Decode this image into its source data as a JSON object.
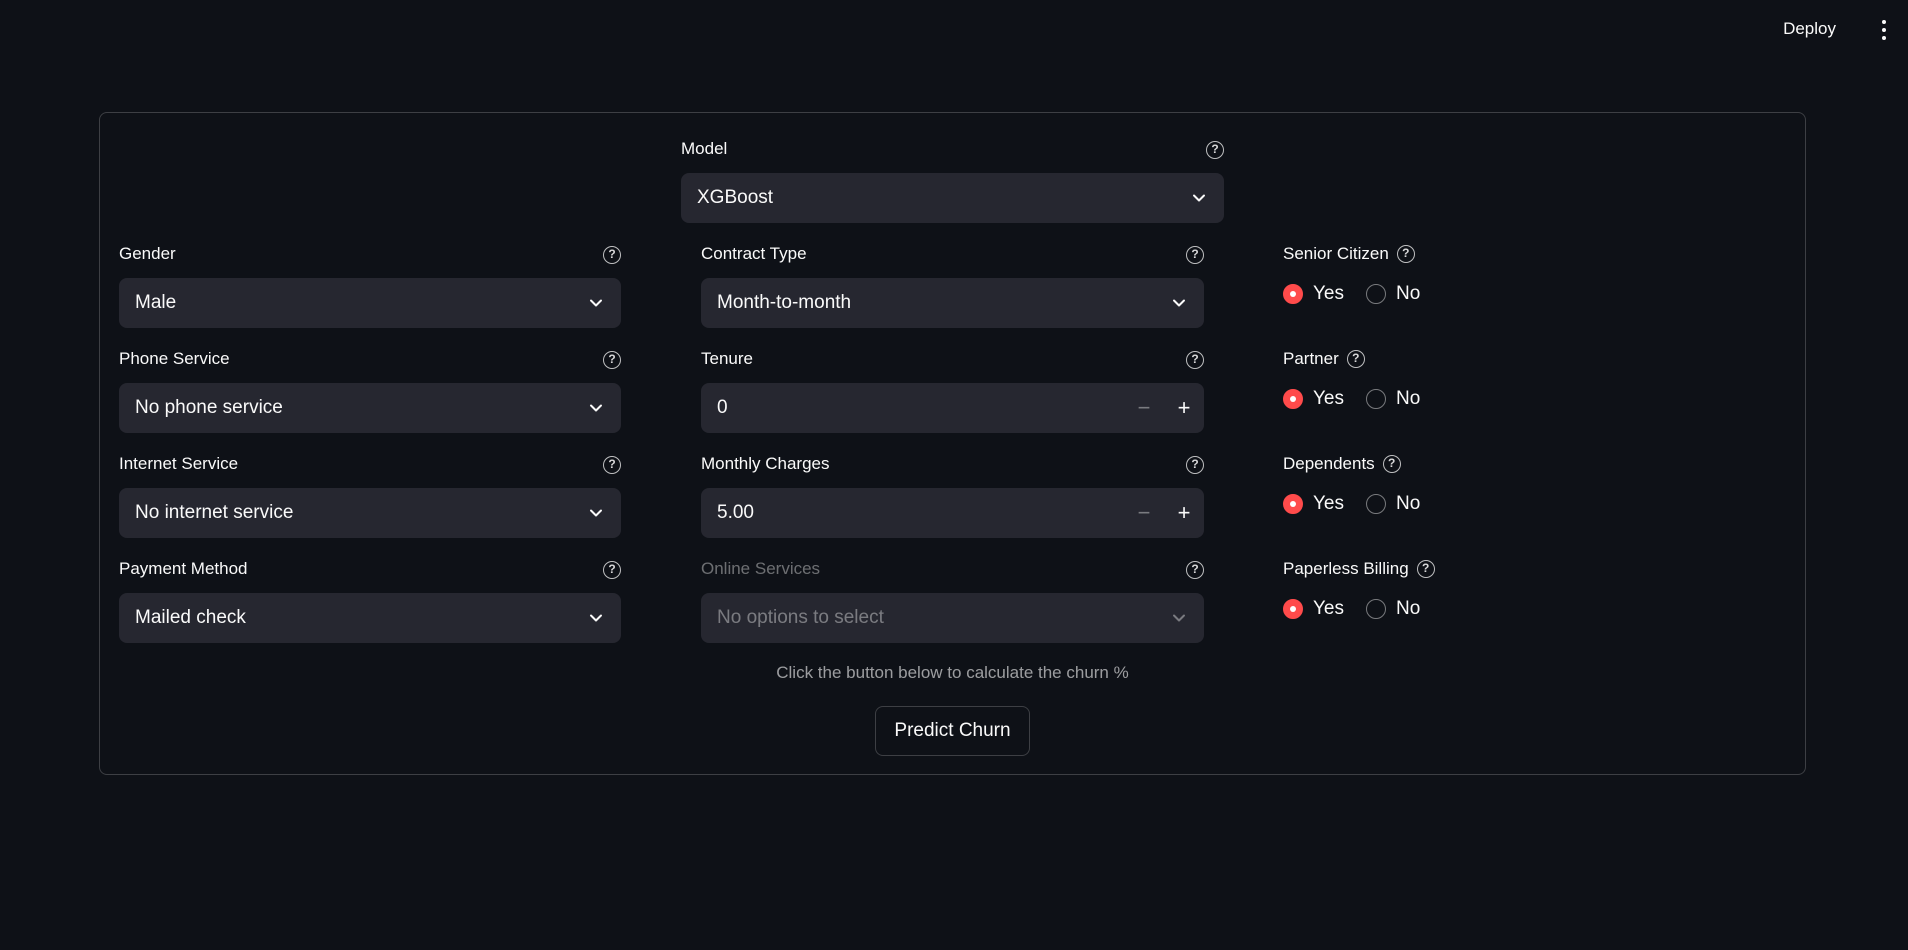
{
  "header": {
    "deploy_label": "Deploy",
    "menu_icon": "kebab-menu-icon"
  },
  "form": {
    "model": {
      "label": "Model",
      "value": "XGBoost"
    },
    "gender": {
      "label": "Gender",
      "value": "Male"
    },
    "phone_service": {
      "label": "Phone Service",
      "value": "No phone service"
    },
    "internet_service": {
      "label": "Internet Service",
      "value": "No internet service"
    },
    "payment_method": {
      "label": "Payment Method",
      "value": "Mailed check"
    },
    "contract_type": {
      "label": "Contract Type",
      "value": "Month-to-month"
    },
    "tenure": {
      "label": "Tenure",
      "value": "0",
      "minus": "−",
      "plus": "+"
    },
    "monthly_charges": {
      "label": "Monthly Charges",
      "value": "5.00",
      "minus": "−",
      "plus": "+"
    },
    "online_services": {
      "label": "Online Services",
      "placeholder": "No options to select"
    },
    "senior_citizen": {
      "label": "Senior Citizen",
      "options": [
        "Yes",
        "No"
      ],
      "selected": "Yes"
    },
    "partner": {
      "label": "Partner",
      "options": [
        "Yes",
        "No"
      ],
      "selected": "Yes"
    },
    "dependents": {
      "label": "Dependents",
      "options": [
        "Yes",
        "No"
      ],
      "selected": "Yes"
    },
    "paperless_billing": {
      "label": "Paperless Billing",
      "options": [
        "Yes",
        "No"
      ],
      "selected": "Yes"
    },
    "caption": "Click the button below to calculate the churn %",
    "submit_label": "Predict Churn"
  },
  "colors": {
    "background": "#0e1117",
    "input_bg": "#262730",
    "accent": "#ff4b4b",
    "text": "#fafafa"
  },
  "help_glyph": "?"
}
